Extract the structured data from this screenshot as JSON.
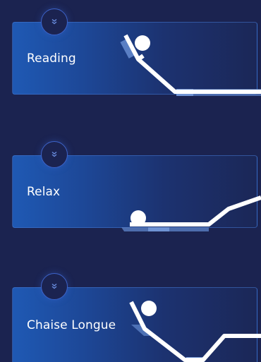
{
  "presets": [
    {
      "label": "Reading",
      "toggle_icon": "double-chevron-down-icon"
    },
    {
      "label": "Relax",
      "toggle_icon": "double-chevron-down-icon"
    },
    {
      "label": "Chaise Longue",
      "toggle_icon": "double-chevron-down-icon"
    }
  ],
  "colors": {
    "background": "#1b2350",
    "card_gradient_start": "#1f59b4",
    "card_border": "#4678d2",
    "accent": "#3d63c9",
    "mattress": "#ffffff",
    "base": "#5a7fc4"
  }
}
